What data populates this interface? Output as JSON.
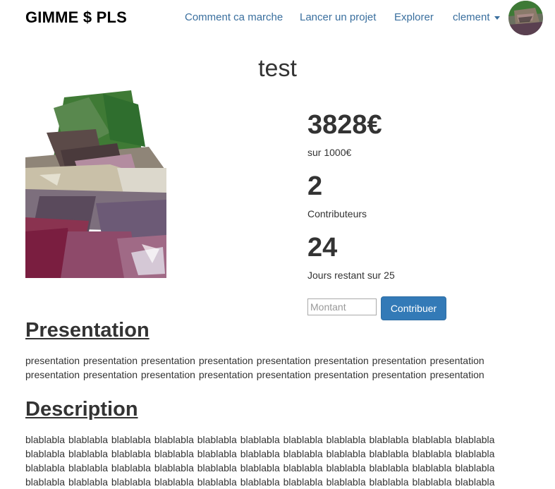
{
  "nav": {
    "brand": "GIMME $ PLS",
    "links": [
      "Comment ca marche",
      "Lancer un projet",
      "Explorer"
    ],
    "user": "clement"
  },
  "project": {
    "title": "test",
    "raised": "3828€",
    "goal_text": "sur 1000€",
    "contributors": "2",
    "contributors_label": "Contributeurs",
    "days_left": "24",
    "days_label": "Jours restant sur 25",
    "amount_placeholder": "Montant",
    "contribute_label": "Contribuer"
  },
  "presentation": {
    "heading": "Presentation",
    "text": "presentation presentation presentation presentation presentation presentation presentation presentation presentation presentation presentation presentation presentation presentation presentation presentation"
  },
  "description": {
    "heading": "Description",
    "text": "blablabla blablabla blablabla blablabla blablabla blablabla blablabla blablabla blablabla blablabla blablabla blablabla blablabla blablabla blablabla blablabla blablabla blablabla blablabla blablabla blablabla blablabla blablabla blablabla blablabla blablabla blablabla blablabla blablabla blablabla blablabla blablabla blablabla blablabla blablabla blablabla blablabla blablabla blablabla blablabla blablabla blablabla blablabla blablabla"
  },
  "colors": {
    "link": "#3a6f9e",
    "primary_button": "#337ab7"
  }
}
